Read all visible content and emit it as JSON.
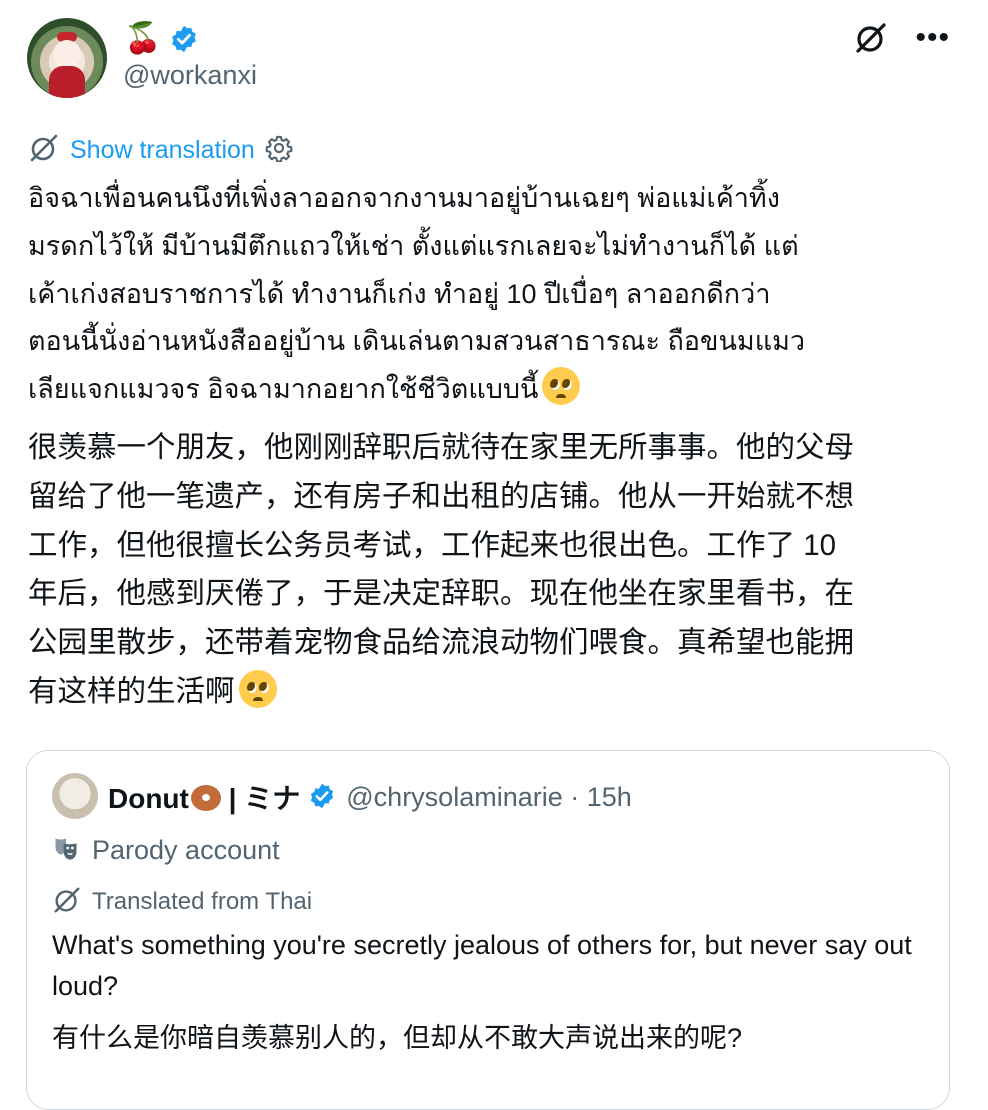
{
  "author": {
    "display_emoji": "🍒",
    "handle": "@workanxi"
  },
  "header": {
    "more_label": "•••"
  },
  "translation": {
    "link_label": "Show translation"
  },
  "post": {
    "thai_text": "อิจฉาเพื่อนคนนึงที่เพิ่งลาออกจากงานมาอยู่บ้านเฉยๆ พ่อแม่เค้าทิ้ง\nมรดกไว้ให้ มีบ้านมีตึกแถวให้เช่า ตั้งแต่แรกเลยจะไม่ทำงานก็ได้ แต่\nเค้าเก่งสอบราชการได้ ทำงานก็เก่ง ทำอยู่ 10 ปีเบื่อๆ ลาออกดีกว่า\nตอนนี้นั่งอ่านหนังสืออยู่บ้าน เดินเล่นตามสวนสาธารณะ ถือขนมแมว\nเลียแจกแมวจร อิจฉามากอยากใช้ชีวิตแบบนี้",
    "chinese_text": "很羡慕一个朋友，他刚刚辞职后就待在家里无所事事。他的父母\n留给了他一笔遗产，还有房子和出租的店铺。他从一开始就不想\n工作，但他很擅长公务员考试，工作起来也很出色。工作了 10\n年后，他感到厌倦了，于是决定辞职。现在他坐在家里看书，在\n公园里散步，还带着宠物食品给流浪动物们喂食。真希望也能拥\n有这样的生活啊"
  },
  "quoted": {
    "name": "Donut",
    "name_suffix": " | ミナ",
    "handle_time": "@chrysolaminarie · 15h",
    "parody_label": "Parody account",
    "translated_label": "Translated from Thai",
    "english_text": "What's something you're secretly jealous of others for, but never say out loud?",
    "chinese_text": "有什么是你暗自羡慕别人的，但却从不敢大声说出来的呢?"
  },
  "colors": {
    "link_blue": "#1d9bf0",
    "secondary_text": "#536471",
    "border": "#cfd9de",
    "verified_blue": "#1d9bf0"
  },
  "icons": [
    "verified-badge-icon",
    "grok-icon",
    "more-icon",
    "translate-icon",
    "gear-icon",
    "parody-mask-icon",
    "pleading-face-emoji"
  ]
}
